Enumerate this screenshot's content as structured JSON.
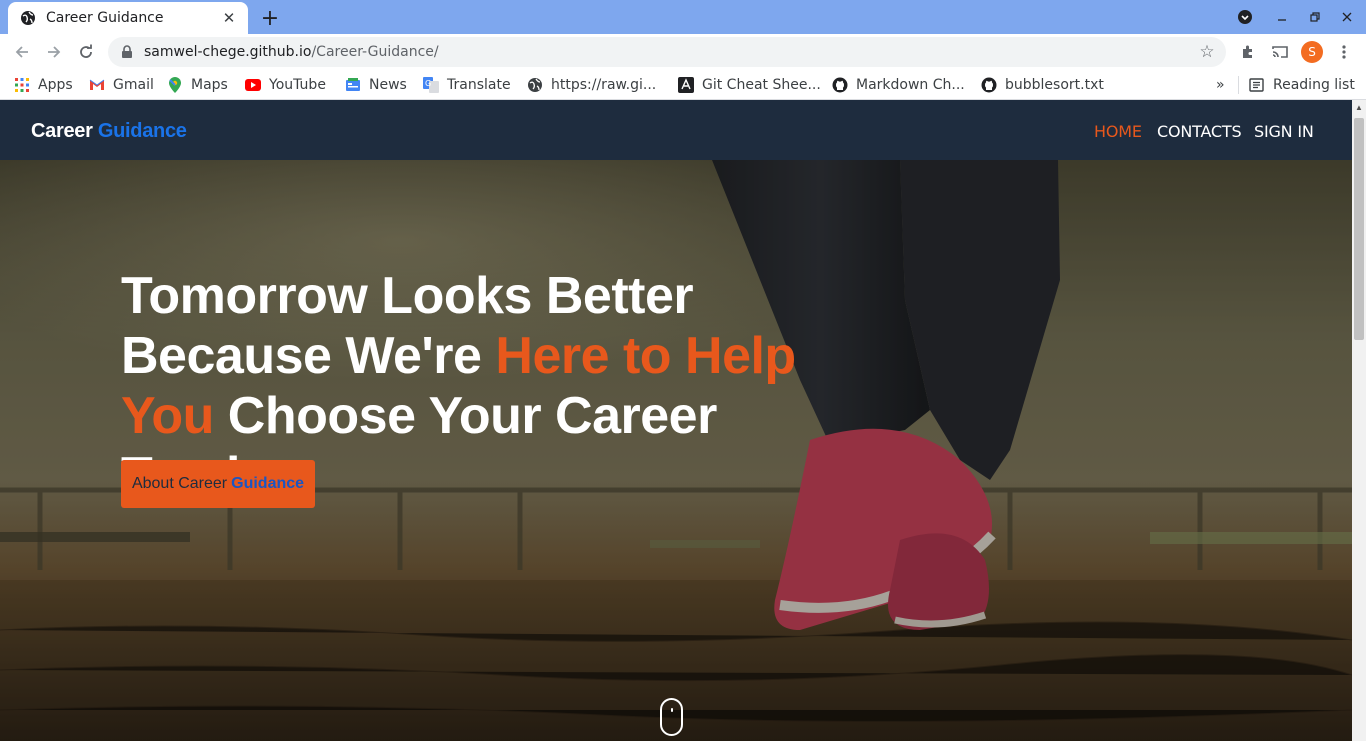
{
  "browser": {
    "tab_title": "Career Guidance",
    "tab_close": "✕",
    "new_tab": "+",
    "url_host": "samwel-chege.github.io",
    "url_path": "/Career-Guidance/",
    "profile_initial": "S",
    "bookmarks": [
      {
        "label": "Apps",
        "icon": "apps-grid-icon"
      },
      {
        "label": "Gmail",
        "icon": "gmail-icon"
      },
      {
        "label": "Maps",
        "icon": "maps-pin-icon"
      },
      {
        "label": "YouTube",
        "icon": "youtube-icon"
      },
      {
        "label": "News",
        "icon": "news-icon"
      },
      {
        "label": "Translate",
        "icon": "translate-icon"
      },
      {
        "label": "https://raw.gi...",
        "icon": "globe-icon"
      },
      {
        "label": "Git Cheat Shee...",
        "icon": "git-icon"
      },
      {
        "label": "Markdown Ch...",
        "icon": "github-icon"
      },
      {
        "label": "bubblesort.txt",
        "icon": "github-icon"
      }
    ],
    "bookmarks_overflow": "»",
    "reading_list": "Reading list"
  },
  "site": {
    "brand_main": "Career",
    "brand_accent": "Guidance",
    "nav": [
      {
        "label": "HOME",
        "active": true
      },
      {
        "label": "CONTACTS",
        "active": false
      },
      {
        "label": "SIGN IN",
        "active": false
      }
    ],
    "hero": {
      "line1": "Tomorrow Looks Better",
      "line2_start": "Because We're ",
      "line2_highlight": "Here to Help",
      "line3_highlight": "You",
      "line3_end": " Choose Your Career Track.",
      "button_main": "About Career",
      "button_accent": "Guidance"
    }
  },
  "colors": {
    "nav_bg": "#1e2c3e",
    "accent_orange": "#e8581c",
    "accent_blue": "#1a73e8",
    "tabstrip": "#7ea7ee"
  }
}
